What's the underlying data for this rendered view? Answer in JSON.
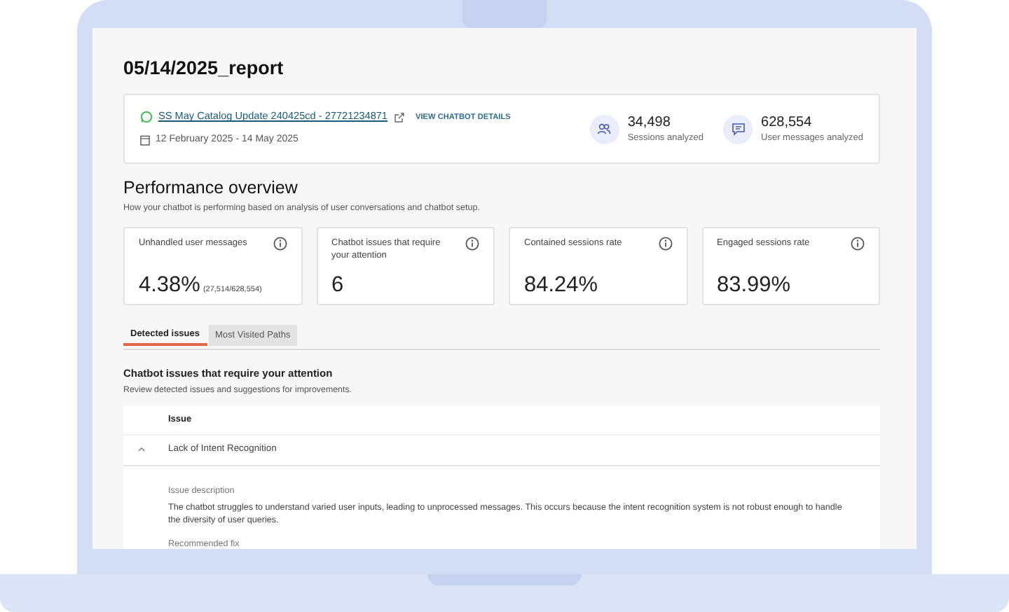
{
  "report_title": "05/14/2025_report",
  "chatbot": {
    "name": "SS May Catalog Update 240425cd - 27721234871",
    "details_link": "VIEW CHATBOT DETAILS",
    "date_range": "12 February 2025 - 14 May 2025"
  },
  "summary_stats": [
    {
      "kind": "sessions",
      "value": "34,498",
      "label": "Sessions analyzed"
    },
    {
      "kind": "messages",
      "value": "628,554",
      "label": "User messages analyzed"
    }
  ],
  "performance": {
    "title": "Performance overview",
    "subtitle": "How your chatbot is performing based on analysis of user conversations and chatbot setup."
  },
  "metrics": [
    {
      "label": "Unhandled user messages",
      "value": "4.38%",
      "detail": "(27,514/628,554)"
    },
    {
      "label": "Chatbot issues that require your attention",
      "value": "6"
    },
    {
      "label": "Contained sessions rate",
      "value": "84.24%"
    },
    {
      "label": "Engaged sessions rate",
      "value": "83.99%"
    }
  ],
  "tabs": [
    {
      "label": "Detected issues",
      "selected": true
    },
    {
      "label": "Most Visited Paths",
      "selected": false
    }
  ],
  "issues_section": {
    "title": "Chatbot issues that require your attention",
    "subtitle": "Review detected issues and suggestions for improvements."
  },
  "table": {
    "columns": [
      "Issue"
    ],
    "rows": [
      {
        "issue": "Lack of Intent Recognition",
        "expanded": true,
        "description_label": "Issue description",
        "description": "The chatbot struggles to understand varied user inputs, leading to unprocessed messages. This occurs because the intent recognition system is not robust enough to handle the diversity of user queries.",
        "fix_label": "Recommended fix"
      }
    ]
  }
}
